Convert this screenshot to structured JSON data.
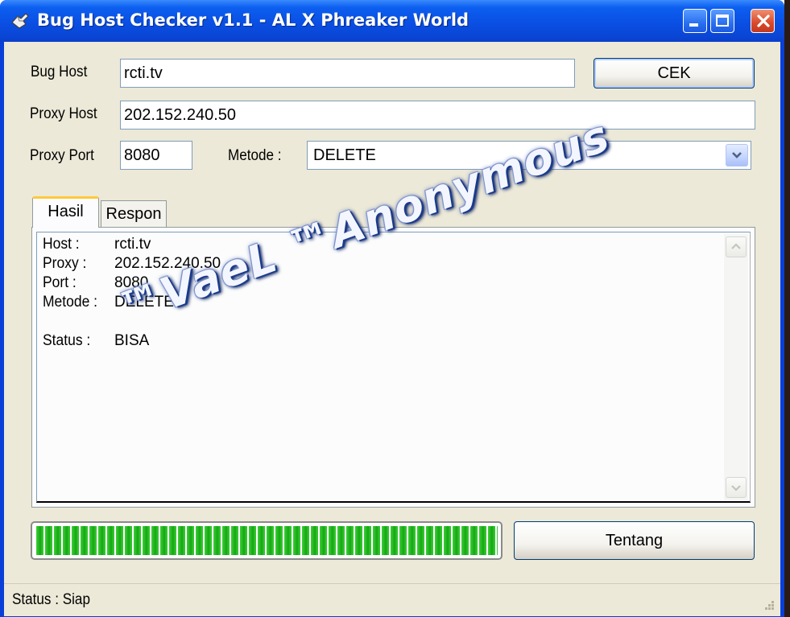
{
  "window": {
    "title": "Bug Host Checker v1.1 - AL X Phreaker World"
  },
  "form": {
    "bug_host_label": "Bug Host",
    "bug_host_value": "rcti.tv",
    "cek_label": "CEK",
    "proxy_host_label": "Proxy Host",
    "proxy_host_value": "202.152.240.50",
    "proxy_port_label": "Proxy Port",
    "proxy_port_value": "8080",
    "metode_label": "Metode :",
    "metode_value": "DELETE"
  },
  "tabs": [
    {
      "label": "Hasil",
      "active": true
    },
    {
      "label": "Respon",
      "active": false
    }
  ],
  "result": {
    "host_key": "Host :",
    "host_val": "rcti.tv",
    "proxy_key": "Proxy :",
    "proxy_val": "202.152.240.50",
    "port_key": "Port :",
    "port_val": "8080",
    "metode_key": "Metode :",
    "metode_val": "DELETE",
    "status_key": "Status :",
    "status_val": "BISA"
  },
  "progress": {
    "percent": 100
  },
  "tentang_label": "Tentang",
  "statusbar": {
    "text": "Status : Siap"
  },
  "watermark": "™VaeL ™Anonymous",
  "colors": {
    "titlebar": "#0a4fe3",
    "client": "#ece9d8",
    "progress_green": "#26b822",
    "close_button": "#d9482a"
  },
  "icons": [
    "app-icon",
    "minimize-icon",
    "maximize-icon",
    "close-icon",
    "chevron-down-icon",
    "scroll-up-icon",
    "scroll-down-icon",
    "resize-grip-icon"
  ]
}
